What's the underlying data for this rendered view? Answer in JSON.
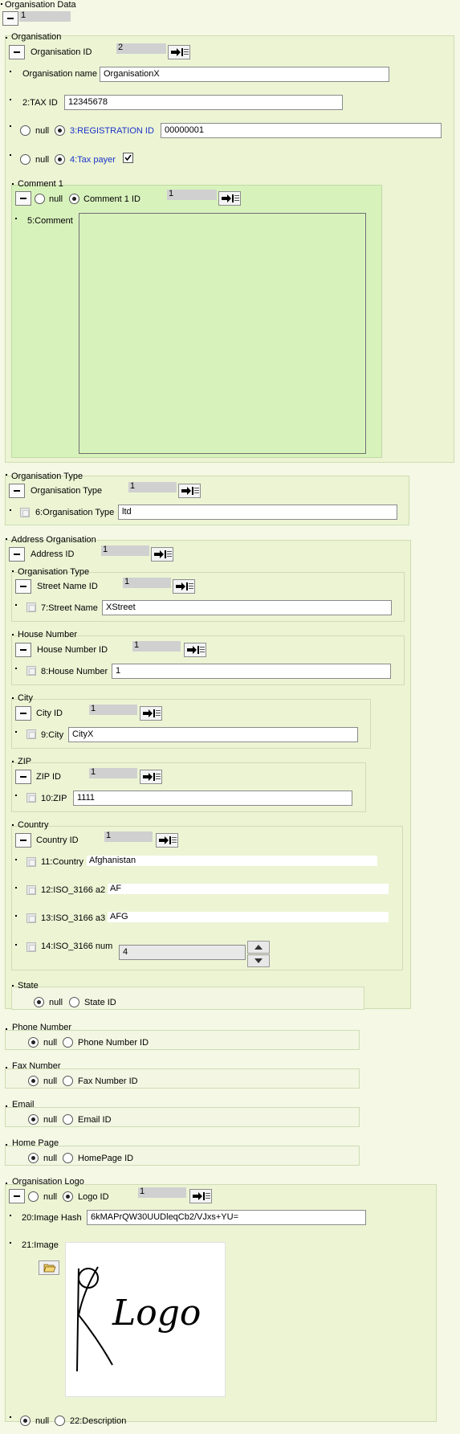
{
  "root": {
    "title": "Organisation Data",
    "id_value": "1"
  },
  "organisation": {
    "title": "Organisation",
    "id_label": "Organisation ID",
    "id_value": "2",
    "name_label": "Organisation name",
    "name_value": "OrganisationX",
    "tax_label": "2:TAX ID",
    "tax_value": "12345678",
    "null_label": "null",
    "reg_label": "3:REGISTRATION ID",
    "reg_value": "00000001",
    "taxpayer_label": "4:Tax payer",
    "taxpayer_checked": true,
    "comment": {
      "title": "Comment 1",
      "id_label": "Comment 1 ID",
      "id_value": "1",
      "comment_label": "5:Comment",
      "comment_value": ""
    }
  },
  "organisation_type": {
    "title": "Organisation Type",
    "id_label": "Organisation Type",
    "id_value": "1",
    "field_label": "6:Organisation Type",
    "field_value": "ltd"
  },
  "address": {
    "title": "Address Organisation",
    "id_label": "Address ID",
    "id_value": "1",
    "street": {
      "title": "Organisation Type",
      "id_label": "Street Name ID",
      "id_value": "1",
      "field_label": "7:Street Name",
      "field_value": "XStreet"
    },
    "house": {
      "title": "House Number",
      "id_label": "House Number ID",
      "id_value": "1",
      "field_label": "8:House Number",
      "field_value": "1"
    },
    "city": {
      "title": "City",
      "id_label": "City ID",
      "id_value": "1",
      "field_label": "9:City",
      "field_value": "CityX"
    },
    "zip": {
      "title": "ZIP",
      "id_label": "ZIP ID",
      "id_value": "1",
      "field_label": "10:ZIP",
      "field_value": "1111"
    },
    "country": {
      "title": "Country",
      "id_label": "Country ID",
      "id_value": "1",
      "country_label": "11:Country",
      "country_value": "Afghanistan",
      "a2_label": "12:ISO_3166 a2",
      "a2_value": "AF",
      "a3_label": "13:ISO_3166 a3",
      "a3_value": "AFG",
      "num_label": "14:ISO_3166 num",
      "num_value": "4"
    },
    "state": {
      "title": "State",
      "null_label": "null",
      "id_label": "State ID"
    }
  },
  "phone": {
    "title": "Phone Number",
    "null_label": "null",
    "id_label": "Phone Number ID"
  },
  "fax": {
    "title": "Fax Number",
    "null_label": "null",
    "id_label": "Fax Number ID"
  },
  "email": {
    "title": "Email",
    "null_label": "null",
    "id_label": "Email ID"
  },
  "homepage": {
    "title": "Home Page",
    "null_label": "null",
    "id_label": "HomePage ID"
  },
  "logo": {
    "title": "Organisation Logo",
    "null_label": "null",
    "id_label": "Logo ID",
    "id_value": "1",
    "hash_label": "20:Image Hash",
    "hash_value": "6kMAPrQW30UUDleqCb2/VJxs+YU=",
    "image_label": "21:Image",
    "image_text": "Logo",
    "desc_null_label": "null",
    "desc_label": "22:Description"
  },
  "colors": {
    "background": "#f4f8e4",
    "comment_group": "#d8f2bc",
    "link_blue": "#1a33c8"
  }
}
